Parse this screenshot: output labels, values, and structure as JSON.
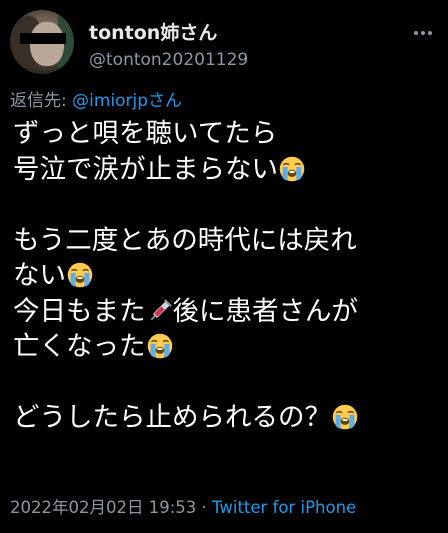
{
  "user": {
    "display_name": "tonton姉さん",
    "handle": "@tonton20201129"
  },
  "reply": {
    "prefix": "返信先: ",
    "mention": "@imiorjpさん"
  },
  "tweet": {
    "lines": [
      "ずっと唄を聴いてたら",
      "号泣で涙が止まらない",
      "",
      "もう二度とあの時代には戻れ",
      "ない",
      "今日もまた",
      "後に患者さんが",
      "亡くなった",
      "",
      "どうしたら止められるの？"
    ]
  },
  "footer": {
    "timestamp": "2022年02月02日 19:53",
    "separator": " · ",
    "source": "Twitter for iPhone"
  },
  "icons": {
    "crying": "loudly-crying-face-emoji",
    "syringe": "syringe-emoji",
    "more": "more-options-icon"
  }
}
